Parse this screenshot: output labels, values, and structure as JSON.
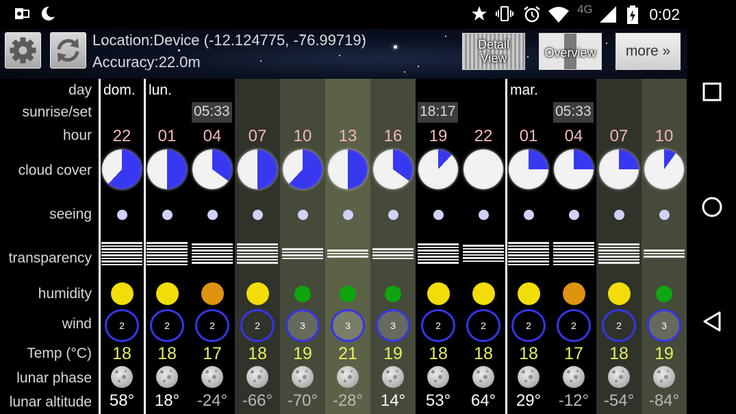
{
  "status_bar": {
    "time": "0:02",
    "network": "4G",
    "icons": [
      "outlook-icon",
      "moon-icon",
      "star-icon",
      "vibrate-icon",
      "alarm-icon",
      "wifi-icon",
      "signal-icon",
      "battery-charging-icon"
    ]
  },
  "header": {
    "location": "Location:Device (-12.124775, -76.99719)",
    "accuracy": "Accuracy:22.0m",
    "detail_view_line1": "Detail",
    "detail_view_line2": "View",
    "overview_label": "Overview",
    "more_label": "more »",
    "settings_icon": "gear-icon",
    "refresh_icon": "refresh-icon"
  },
  "row_labels": {
    "day": "day",
    "sunrise_set": "sunrise/set",
    "hour": "hour",
    "cloud_cover": "cloud cover",
    "seeing": "seeing",
    "transparency": "transparency",
    "humidity": "humidity",
    "wind": "wind",
    "temp": "Temp (°C)",
    "lunar_phase": "lunar phase",
    "lunar_altitude": "lunar altitude"
  },
  "colors": {
    "night": "#000000",
    "twilight": "#2f3329",
    "day_light": "#5c6248",
    "day_mid": "#454a3a",
    "cloud_blue": "#3838f0",
    "cloud_white": "#f2f2f2",
    "humidity_yellow": "#f2dd0a",
    "humidity_orange": "#de9410",
    "humidity_green": "#0ea60e",
    "wind_blue": "#3535e8",
    "alt_positive": "#ffffff",
    "alt_negative": "#b9b9b9"
  },
  "columns": [
    {
      "day": "dom.",
      "sunrise": "",
      "hour": "22",
      "cloud": 0.62,
      "transp": 8,
      "hum": "yellow",
      "hum_size": "big",
      "wind": "2",
      "temp": "18",
      "alt": "58°",
      "bg": "night"
    },
    {
      "day": "lun.",
      "sunrise": "",
      "hour": "01",
      "cloud": 0.5,
      "transp": 8,
      "hum": "yellow",
      "hum_size": "big",
      "wind": "2",
      "temp": "18",
      "alt": "18°",
      "bg": "night"
    },
    {
      "day": "",
      "sunrise": "05:33",
      "hour": "04",
      "cloud": 0.35,
      "transp": 7,
      "hum": "orange",
      "hum_size": "big",
      "wind": "2",
      "temp": "17",
      "alt": "-24°",
      "bg": "night"
    },
    {
      "day": "",
      "sunrise": "",
      "hour": "07",
      "cloud": 0.5,
      "transp": 7,
      "hum": "yellow",
      "hum_size": "big",
      "wind": "2",
      "temp": "18",
      "alt": "-66°",
      "bg": "twilight"
    },
    {
      "day": "",
      "sunrise": "",
      "hour": "10",
      "cloud": 0.62,
      "transp": 4,
      "hum": "green",
      "hum_size": "small",
      "wind": "3",
      "temp": "19",
      "alt": "-70°",
      "bg": "day_mid"
    },
    {
      "day": "",
      "sunrise": "",
      "hour": "13",
      "cloud": 0.5,
      "transp": 3,
      "hum": "green",
      "hum_size": "small",
      "wind": "3",
      "temp": "21",
      "alt": "-28°",
      "bg": "day_light"
    },
    {
      "day": "",
      "sunrise": "",
      "hour": "16",
      "cloud": 0.35,
      "transp": 4,
      "hum": "green",
      "hum_size": "small",
      "wind": "3",
      "temp": "19",
      "alt": "14°",
      "bg": "day_mid"
    },
    {
      "day": "",
      "sunrise": "18:17",
      "hour": "19",
      "cloud": 0.12,
      "transp": 7,
      "hum": "yellow",
      "hum_size": "big",
      "wind": "2",
      "temp": "18",
      "alt": "53°",
      "bg": "night"
    },
    {
      "day": "",
      "sunrise": "",
      "hour": "22",
      "cloud": 0.0,
      "transp": 6,
      "hum": "yellow",
      "hum_size": "big",
      "wind": "2",
      "temp": "18",
      "alt": "64°",
      "bg": "night"
    },
    {
      "day": "mar.",
      "sunrise": "",
      "hour": "01",
      "cloud": 0.25,
      "transp": 8,
      "hum": "yellow",
      "hum_size": "big",
      "wind": "2",
      "temp": "18",
      "alt": "29°",
      "bg": "night"
    },
    {
      "day": "",
      "sunrise": "05:33",
      "hour": "04",
      "cloud": 0.25,
      "transp": 8,
      "hum": "orange",
      "hum_size": "big",
      "wind": "2",
      "temp": "17",
      "alt": "-12°",
      "bg": "night"
    },
    {
      "day": "",
      "sunrise": "",
      "hour": "07",
      "cloud": 0.25,
      "transp": 7,
      "hum": "yellow",
      "hum_size": "big",
      "wind": "2",
      "temp": "18",
      "alt": "-54°",
      "bg": "twilight"
    },
    {
      "day": "",
      "sunrise": "",
      "hour": "10",
      "cloud": 0.1,
      "transp": 3,
      "hum": "green",
      "hum_size": "small",
      "wind": "3",
      "temp": "19",
      "alt": "-84°",
      "bg": "day_mid"
    }
  ],
  "nav_bar": {
    "icons": [
      "recents-square-icon",
      "home-circle-icon",
      "back-triangle-icon"
    ]
  }
}
